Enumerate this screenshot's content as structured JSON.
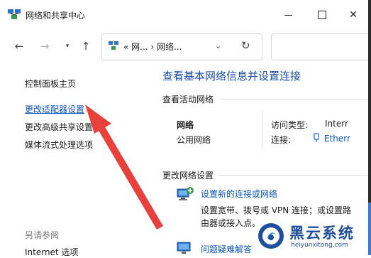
{
  "window": {
    "title": "网络和共享中心",
    "controls": {
      "minimize": "minimize",
      "maximize": "maximize",
      "close": "✕"
    }
  },
  "address": {
    "path": "« 网... › 网络..."
  },
  "left_pane": {
    "links": [
      {
        "label": "控制面板主页"
      },
      {
        "label": "更改适配器设置"
      },
      {
        "label": "更改高级共享设置"
      },
      {
        "label": "媒体流式处理选项"
      }
    ],
    "see_also": "另请参阅",
    "internet_options": "Internet 选项"
  },
  "main": {
    "heading": "查看基本网络信息并设置连接",
    "active_networks_label": "查看活动网络",
    "network": {
      "name": "网络",
      "type": "公用网络",
      "access_type_label": "访问类型:",
      "access_type_value": "Interr",
      "connections_label": "连接:",
      "connections_value": "Etherr"
    },
    "change_settings_label": "更改网络设置",
    "new_connection": {
      "link": "设置新的连接或网络",
      "description": "设置宽带、拨号或 VPN 连接；或设置路由器或接入点。"
    },
    "troubleshoot": {
      "link": "问题疑难解答"
    }
  },
  "watermark": {
    "brand": "黑云系统",
    "url": "heiyunxitong.com"
  },
  "colors": {
    "link_blue": "#0b55b7",
    "heading_blue": "#1a4fa0",
    "annotation_red": "#e8403a",
    "watermark_blue": "#1d4f9c"
  },
  "icons": {
    "title": "network-center-icon",
    "back": "arrow-left-icon",
    "forward": "arrow-right-icon",
    "recent": "chevron-down-icon",
    "up": "arrow-up-icon",
    "address": "network-center-icon",
    "refresh": "refresh-icon",
    "connection": "ethernet-icon",
    "new_connection": "new-connection-icon",
    "troubleshoot": "troubleshoot-icon"
  }
}
